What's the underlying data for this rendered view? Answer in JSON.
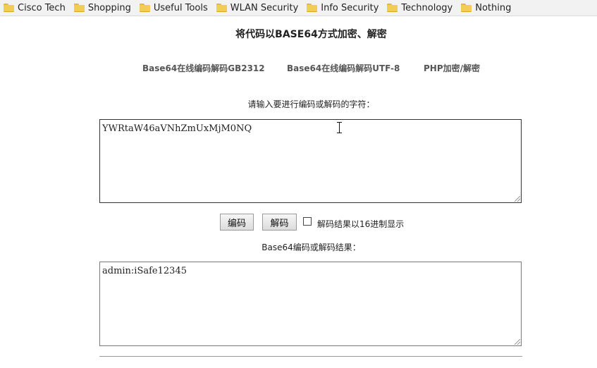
{
  "bookmarks": [
    {
      "label": "Cisco Tech"
    },
    {
      "label": "Shopping"
    },
    {
      "label": "Useful Tools"
    },
    {
      "label": "WLAN Security"
    },
    {
      "label": "Info Security"
    },
    {
      "label": "Technology"
    },
    {
      "label": "Nothing"
    }
  ],
  "page_title": "将代码以BASE64方式加密、解密",
  "nav_links": [
    {
      "label": "Base64在线编码解码GB2312"
    },
    {
      "label": "Base64在线编码解码UTF-8"
    },
    {
      "label": "PHP加密/解密"
    }
  ],
  "input_label": "请输入要进行编码或解码的字符：",
  "input_value": "YWRtaW46aVNhZmUxMjM0NQ",
  "buttons": {
    "encode": "编码",
    "decode": "解码"
  },
  "hex_checkbox": {
    "label": "解码结果以16进制显示",
    "checked": false
  },
  "output_label": "Base64编码或解码结果：",
  "output_value": "admin:iSafe12345"
}
